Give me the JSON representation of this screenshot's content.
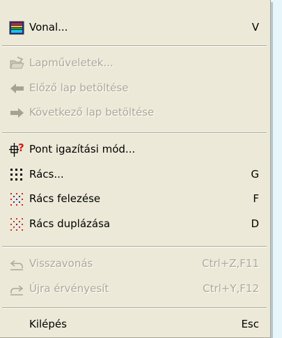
{
  "menu": {
    "items": [
      {
        "label": "Vonal...",
        "shortcut": "V",
        "icon": "line-style-icon",
        "enabled": true
      },
      {
        "label": "Lapműveletek...",
        "shortcut": "",
        "icon": "folder-open-icon",
        "enabled": false
      },
      {
        "label": "Előző lap betöltése",
        "shortcut": "",
        "icon": "arrow-left-icon",
        "enabled": false
      },
      {
        "label": "Következő lap betöltése",
        "shortcut": "",
        "icon": "arrow-right-icon",
        "enabled": false
      },
      {
        "label": "Pont igazítási mód...",
        "shortcut": "",
        "icon": "snap-point-icon",
        "enabled": true
      },
      {
        "label": "Rács...",
        "shortcut": "G",
        "icon": "grid-icon",
        "enabled": true
      },
      {
        "label": "Rács felezése",
        "shortcut": "F",
        "icon": "grid-halve-icon",
        "enabled": true
      },
      {
        "label": "Rács duplázása",
        "shortcut": "D",
        "icon": "grid-double-icon",
        "enabled": true
      },
      {
        "label": "Visszavonás",
        "shortcut": "Ctrl+Z,F11",
        "icon": "undo-icon",
        "enabled": false
      },
      {
        "label": "Újra érvényesít",
        "shortcut": "Ctrl+Y,F12",
        "icon": "redo-icon",
        "enabled": false
      },
      {
        "label": "Kilépés",
        "shortcut": "Esc",
        "icon": "",
        "enabled": true
      }
    ]
  }
}
